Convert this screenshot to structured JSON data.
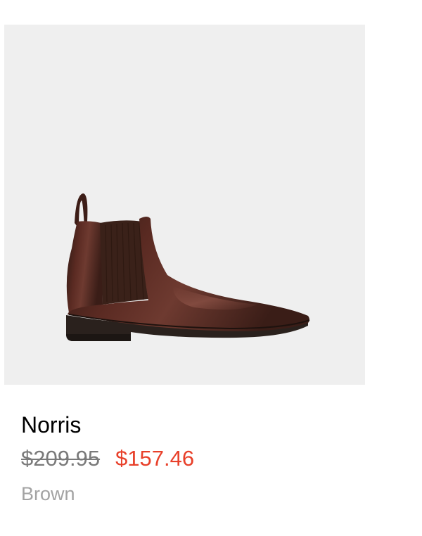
{
  "product": {
    "image_icon": "chelsea-boot-image",
    "name": "Norris",
    "original_price": "$209.95",
    "sale_price": "$157.46",
    "color": "Brown"
  },
  "colors": {
    "sale_price": "#e8402a",
    "image_background": "#efefef"
  }
}
